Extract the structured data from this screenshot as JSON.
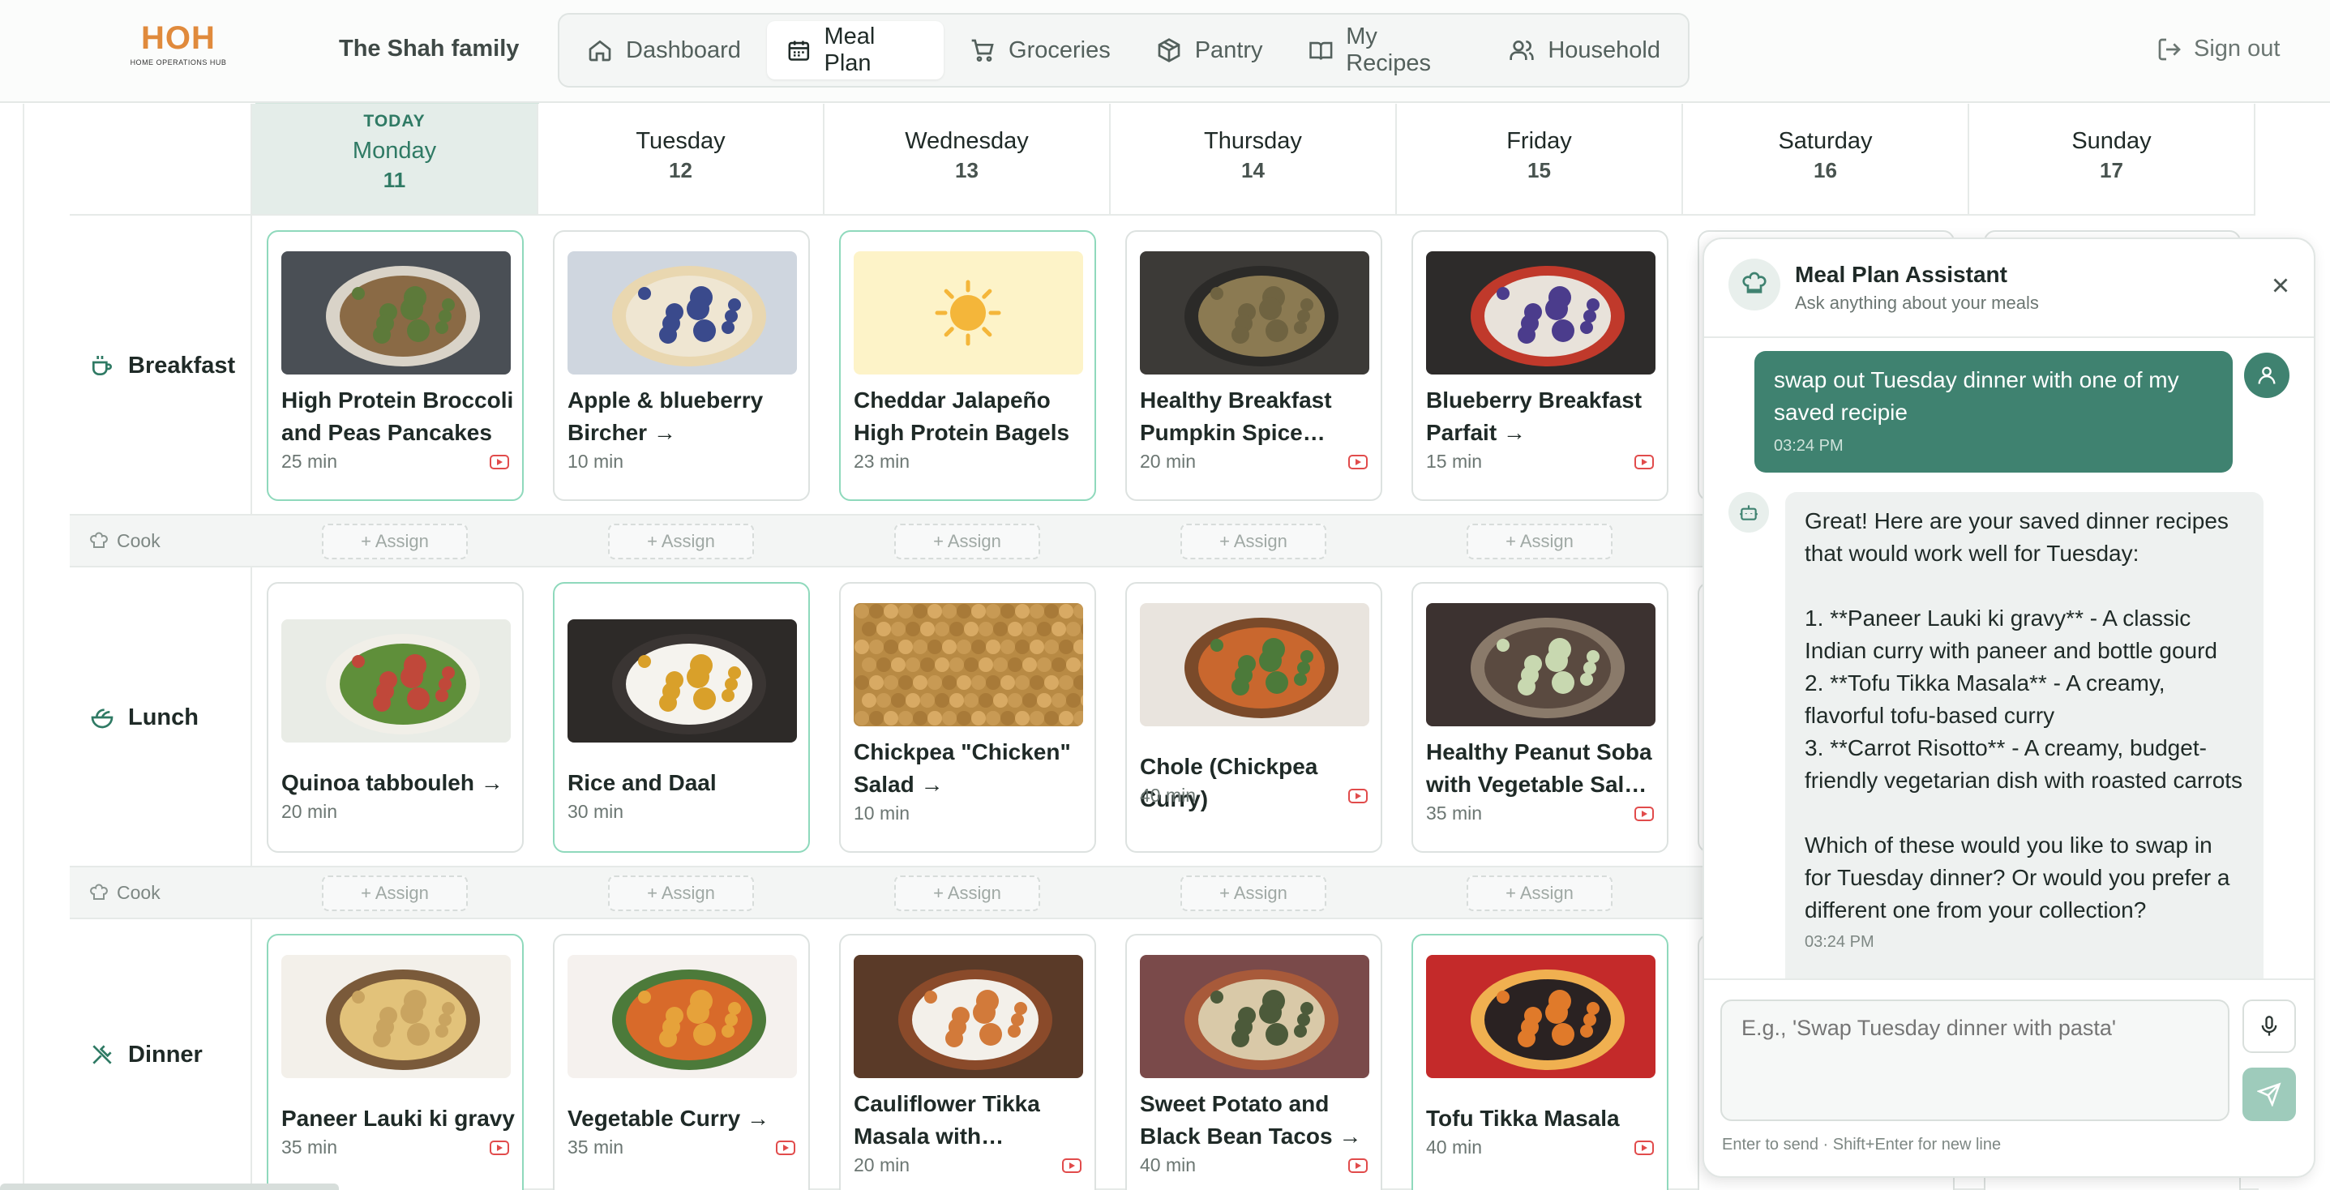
{
  "header": {
    "logo_text": "HOH",
    "logo_sub": "HOME OPERATIONS HUB",
    "family_name": "The Shah family",
    "nav": [
      {
        "label": "Dashboard",
        "icon": "home-icon"
      },
      {
        "label": "Meal Plan",
        "icon": "calendar-icon",
        "active": true
      },
      {
        "label": "Groceries",
        "icon": "cart-icon"
      },
      {
        "label": "Pantry",
        "icon": "box-icon"
      },
      {
        "label": "My Recipes",
        "icon": "book-icon"
      },
      {
        "label": "Household",
        "icon": "users-icon"
      }
    ],
    "signout": "Sign out"
  },
  "days": [
    {
      "name": "Monday",
      "num": "11",
      "today_label": "TODAY"
    },
    {
      "name": "Tuesday",
      "num": "12"
    },
    {
      "name": "Wednesday",
      "num": "13"
    },
    {
      "name": "Thursday",
      "num": "14"
    },
    {
      "name": "Friday",
      "num": "15"
    },
    {
      "name": "Saturday",
      "num": "16"
    },
    {
      "name": "Sunday",
      "num": "17"
    }
  ],
  "meals": [
    {
      "label": "Breakfast",
      "icon": "coffee-icon",
      "cards": [
        {
          "title": "High Protein Broccoli and Peas Pancakes",
          "time": "25 min",
          "video": true,
          "highlight": true,
          "img": "pancakes"
        },
        {
          "title": "Apple & blueberry Bircher →",
          "time": "10 min",
          "video": false,
          "highlight": false,
          "img": "bircher"
        },
        {
          "title": "Cheddar Jalapeño High Protein Bagels",
          "time": "23 min",
          "video": false,
          "highlight": true,
          "img": "sun"
        },
        {
          "title": "Healthy Breakfast Pumpkin Spice…",
          "time": "20 min",
          "video": true,
          "highlight": false,
          "img": "oats"
        },
        {
          "title": "Blueberry Breakfast Parfait →",
          "time": "15 min",
          "video": true,
          "highlight": false,
          "img": "parfait"
        }
      ]
    },
    {
      "label": "Lunch",
      "icon": "salad-icon",
      "cards": [
        {
          "title": "Quinoa tabbouleh →",
          "time": "20 min",
          "video": false,
          "highlight": false,
          "img": "tabbouleh"
        },
        {
          "title": "Rice and Daal",
          "time": "30 min",
          "video": false,
          "highlight": true,
          "img": "daal"
        },
        {
          "title": "Chickpea \"Chicken\" Salad →",
          "time": "10 min",
          "video": false,
          "highlight": false,
          "img": "chickpea"
        },
        {
          "title": "Chole (Chickpea Curry)",
          "time": "40 min",
          "video": true,
          "highlight": false,
          "img": "chole"
        },
        {
          "title": "Healthy Peanut Soba with Vegetable Sal…",
          "time": "35 min",
          "video": true,
          "highlight": false,
          "img": "soba"
        }
      ]
    },
    {
      "label": "Dinner",
      "icon": "utensils-icon",
      "cards": [
        {
          "title": "Paneer Lauki ki gravy",
          "time": "35 min",
          "video": true,
          "highlight": true,
          "img": "lauki"
        },
        {
          "title": "Vegetable Curry →",
          "time": "35 min",
          "video": true,
          "highlight": false,
          "img": "vegcurry"
        },
        {
          "title": "Cauliflower Tikka Masala with…",
          "time": "20 min",
          "video": true,
          "highlight": false,
          "img": "cauli"
        },
        {
          "title": "Sweet Potato and Black Bean Tacos →",
          "time": "40 min",
          "video": true,
          "highlight": false,
          "img": "tacos"
        },
        {
          "title": "Tofu Tikka Masala",
          "time": "40 min",
          "video": true,
          "highlight": true,
          "img": "tofu"
        }
      ]
    }
  ],
  "cook": {
    "label": "Cook",
    "assign": "+ Assign"
  },
  "chat": {
    "title": "Meal Plan Assistant",
    "subtitle": "Ask anything about your meals",
    "user_message": "swap out Tuesday dinner with one of my saved recipie",
    "user_time": "03:24 PM",
    "bot_message": "Great! Here are your saved dinner recipes that would work well for Tuesday:\n\n1. **Paneer Lauki ki gravy** - A classic Indian curry with paneer and bottle gourd\n2. **Tofu Tikka Masala** - A creamy, flavorful tofu-based curry\n3. **Carrot Risotto** - A creamy, budget-friendly vegetarian dish with roasted carrots\n\nWhich of these would you like to swap in for Tuesday dinner? Or would you prefer a different one from your collection?",
    "bot_time": "03:24 PM",
    "placeholder": "E.g., 'Swap Tuesday dinner with pasta'",
    "hint": "Enter to send · Shift+Enter for new line"
  },
  "colors": {
    "accent": "#3f8270",
    "today_bg": "#e4ede9",
    "highlight_border": "#8fd9bc",
    "video_red": "#e14b4b"
  }
}
